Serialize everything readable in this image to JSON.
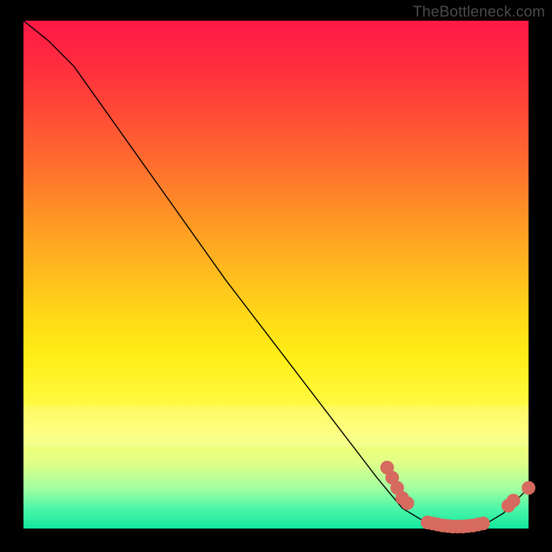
{
  "watermark": "TheBottleneck.com",
  "chart_data": {
    "type": "line",
    "title": "",
    "xlabel": "",
    "ylabel": "",
    "xlim": [
      0,
      100
    ],
    "ylim": [
      0,
      100
    ],
    "grid": false,
    "legend": false,
    "series": [
      {
        "name": "bottleneck-curve",
        "x": [
          0,
          5,
          10,
          15,
          20,
          30,
          40,
          50,
          60,
          70,
          75,
          80,
          85,
          90,
          95,
          100
        ],
        "y": [
          100,
          96,
          91,
          84,
          77,
          63,
          49,
          36,
          23,
          10,
          4,
          1,
          0,
          0,
          3,
          8
        ]
      }
    ],
    "markers": [
      {
        "name": "gpu-point",
        "x": 72,
        "y": 12
      },
      {
        "name": "gpu-point",
        "x": 73,
        "y": 10
      },
      {
        "name": "gpu-point",
        "x": 74,
        "y": 8
      },
      {
        "name": "gpu-point",
        "x": 75,
        "y": 6
      },
      {
        "name": "gpu-point",
        "x": 76,
        "y": 5
      },
      {
        "name": "match-point",
        "x": 80,
        "y": 1.2
      },
      {
        "name": "match-point",
        "x": 81,
        "y": 1.0
      },
      {
        "name": "match-point",
        "x": 82,
        "y": 0.8
      },
      {
        "name": "match-point",
        "x": 83,
        "y": 0.6
      },
      {
        "name": "match-point",
        "x": 84,
        "y": 0.5
      },
      {
        "name": "match-point",
        "x": 85,
        "y": 0.4
      },
      {
        "name": "match-point",
        "x": 86,
        "y": 0.4
      },
      {
        "name": "match-point",
        "x": 87,
        "y": 0.4
      },
      {
        "name": "match-point",
        "x": 88,
        "y": 0.5
      },
      {
        "name": "match-point",
        "x": 89,
        "y": 0.6
      },
      {
        "name": "match-point",
        "x": 90,
        "y": 0.8
      },
      {
        "name": "match-point",
        "x": 91,
        "y": 1.0
      },
      {
        "name": "cpu-point",
        "x": 96,
        "y": 4.5
      },
      {
        "name": "cpu-point",
        "x": 97,
        "y": 5.5
      },
      {
        "name": "cpu-point",
        "x": 100,
        "y": 8
      }
    ],
    "colors": {
      "curve": "#000000",
      "marker": "#d66a5f",
      "gradient_top": "#ff1846",
      "gradient_bottom": "#13e79f"
    }
  }
}
